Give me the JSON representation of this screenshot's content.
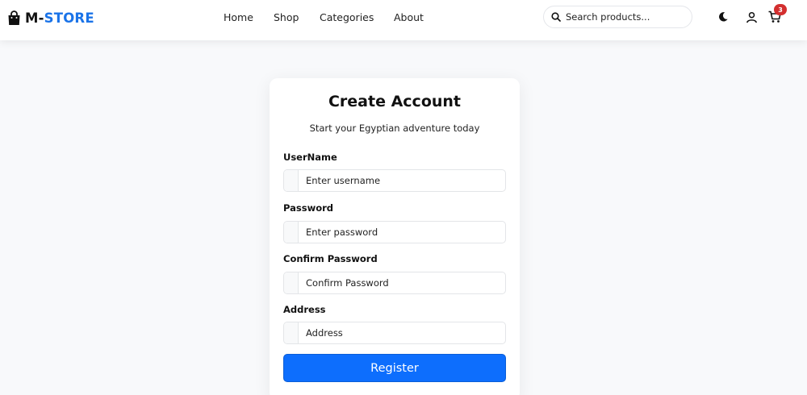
{
  "brand": {
    "prefix": "M-",
    "name": "STORE",
    "icon": "shopping-bag-icon"
  },
  "nav": {
    "links": [
      {
        "label": "Home"
      },
      {
        "label": "Shop"
      },
      {
        "label": "Categories"
      },
      {
        "label": "About"
      }
    ]
  },
  "search": {
    "placeholder": "Search products...",
    "icon": "search-icon"
  },
  "toolbar": {
    "theme_icon": "moon-icon",
    "account_icon": "user-icon",
    "cart_icon": "cart-icon",
    "cart_count": "3"
  },
  "form": {
    "title": "Create Account",
    "subtitle": "Start your Egyptian adventure today",
    "fields": [
      {
        "label": "UserName",
        "placeholder": "Enter username",
        "type": "text"
      },
      {
        "label": "Password",
        "placeholder": "Enter password",
        "type": "password"
      },
      {
        "label": "Confirm Password",
        "placeholder": "Confirm Password",
        "type": "password"
      },
      {
        "label": "Address",
        "placeholder": "Address",
        "type": "text"
      }
    ],
    "submit_label": "Register"
  },
  "colors": {
    "accent": "#0d6efd",
    "brand_blue": "#1a73e8",
    "badge": "#d32f2f",
    "page_background": "#f8f9fb"
  }
}
